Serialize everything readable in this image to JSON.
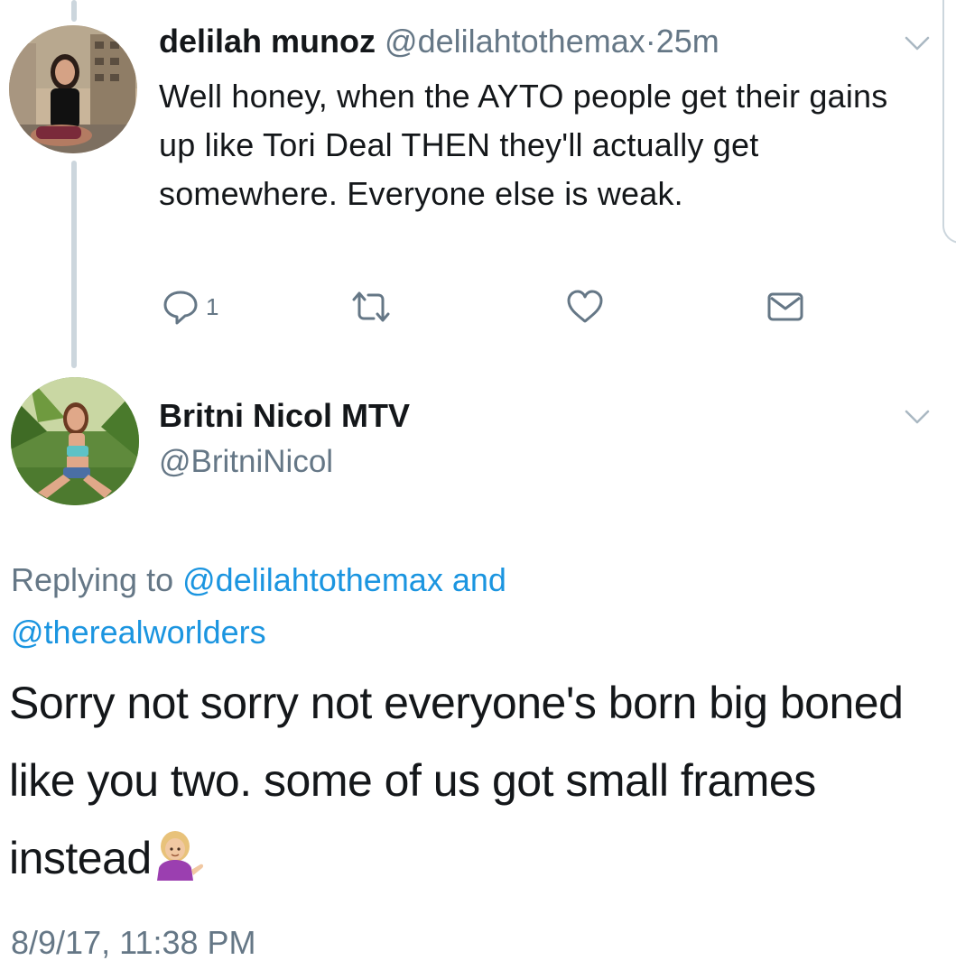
{
  "tweet1": {
    "name": "delilah munoz",
    "handle": "@delilahtothemax",
    "separator": "·",
    "time": "25m",
    "text": "Well honey, when the AYTO people get their gains up like Tori Deal THEN they'll actually get somewhere. Everyone else is weak.",
    "reply_count": "1",
    "avatar_icon": "user-photo-avatar"
  },
  "tweet2": {
    "name": "Britni Nicol MTV",
    "handle": "@BritniNicol",
    "replying_prefix": "Replying to",
    "replying_mention1": "@delilahtothemax",
    "replying_and": "and",
    "replying_mention2": "@therealworlders",
    "text": "Sorry not sorry not everyone's born big boned like you two. some of us got small frames instead",
    "emoji": "person-tipping-hand-emoji",
    "timestamp": "8/9/17, 11:38 PM",
    "avatar_icon": "user-photo-avatar"
  },
  "colors": {
    "text": "#14171a",
    "secondary": "#657786",
    "link": "#1b95e0",
    "thread_line": "#ccd6dd"
  },
  "icons": [
    "reply-icon",
    "retweet-icon",
    "like-icon",
    "direct-message-icon",
    "chevron-down-icon"
  ]
}
